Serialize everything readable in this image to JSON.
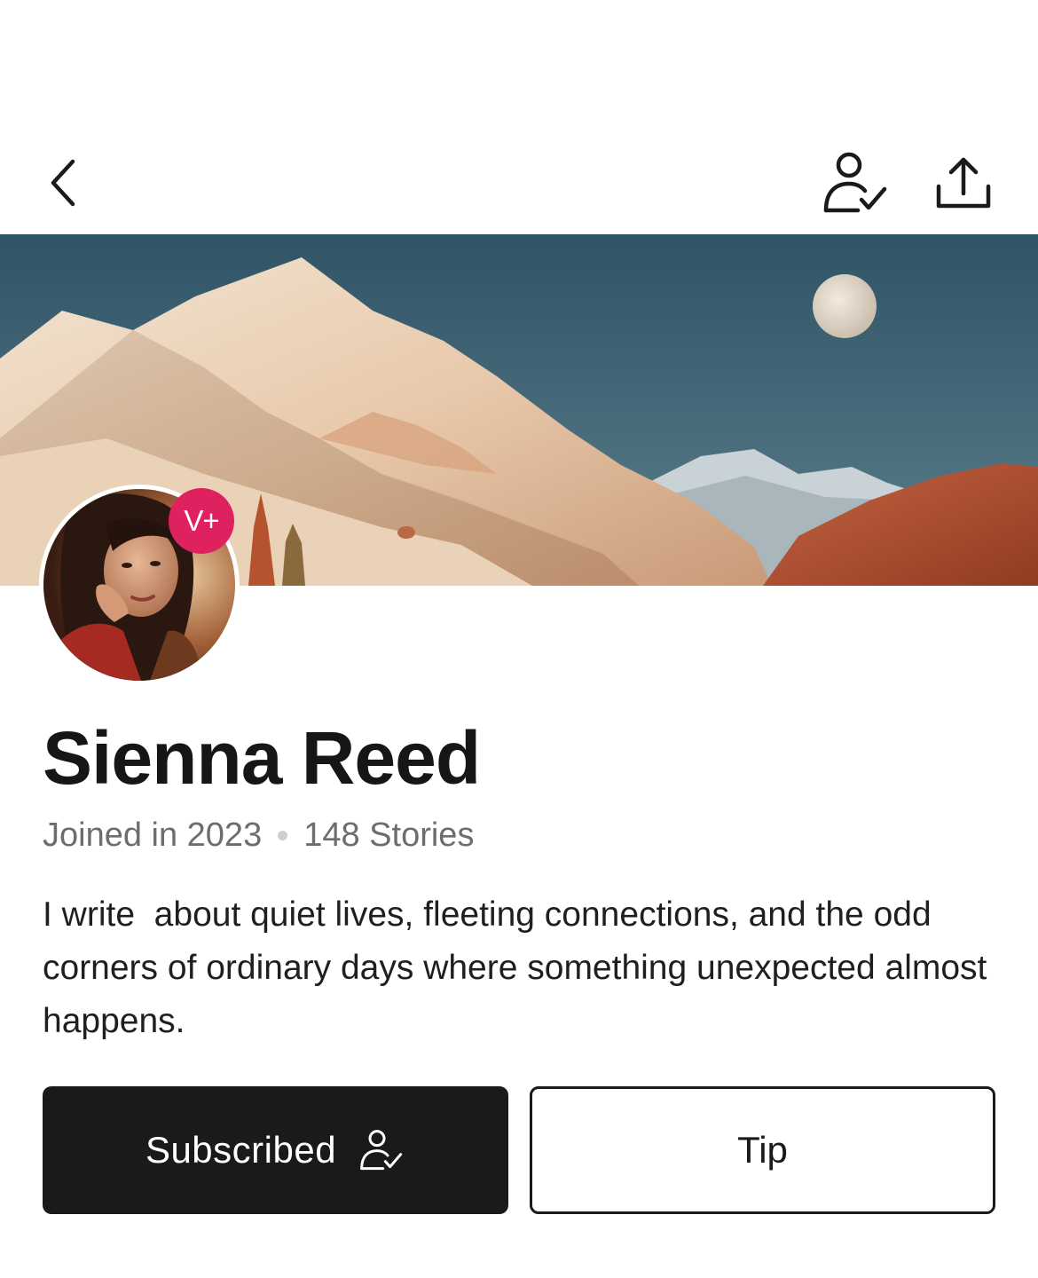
{
  "header": {
    "back_icon": "chevron-left-icon",
    "follow_icon": "user-check-icon",
    "share_icon": "share-upload-icon"
  },
  "profile": {
    "name": "Sienna Reed",
    "badge": "V+",
    "joined": "Joined in 2023",
    "stories": "148 Stories",
    "bio": "I write  about quiet lives, fleeting connections, and the odd corners of ordinary days where something unexpected almost happens."
  },
  "actions": {
    "subscribed_label": "Subscribed",
    "subscribed_icon": "user-check-icon",
    "tip_label": "Tip"
  },
  "colors": {
    "badge": "#e0215f",
    "primary_button": "#1a1a1a",
    "muted_text": "#6d6d6d"
  }
}
